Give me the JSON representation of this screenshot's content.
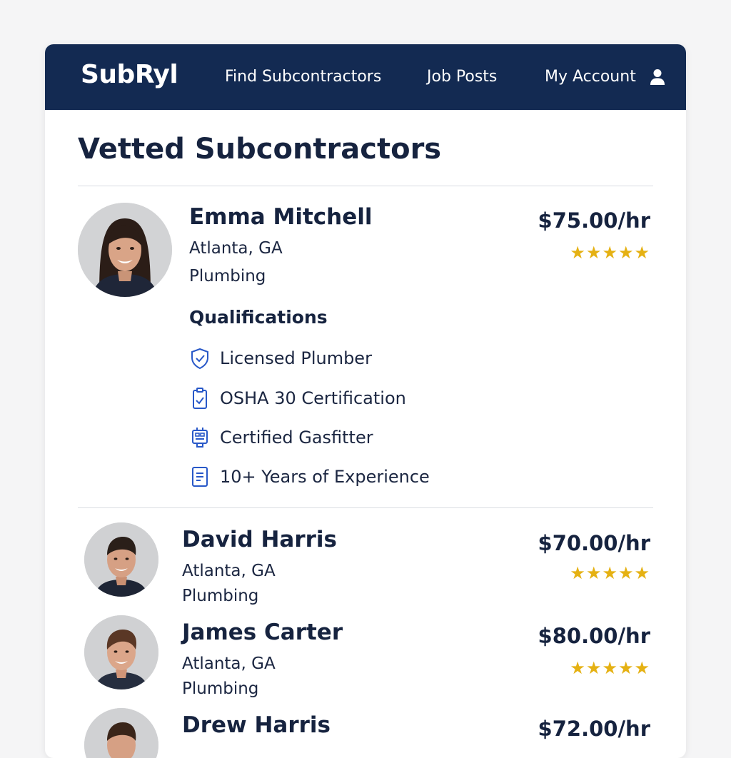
{
  "navbar": {
    "brand": "SubRyl",
    "links": [
      "Find Subcontractors",
      "Job Posts",
      "My Account"
    ],
    "account_icon": "user-icon"
  },
  "page": {
    "title": "Vetted Subcontractors"
  },
  "colors": {
    "navbar_bg": "#132a52",
    "text": "#16233f",
    "star": "#e5b113",
    "icon_blue": "#2858c8"
  },
  "subcontractors": [
    {
      "name": "Emma Mitchell",
      "location": "Atlanta, GA",
      "trade": "Plumbing",
      "rate": "$75.00/hr",
      "rating": 5,
      "stars": "★★★★★",
      "qualifications_heading": "Qualifications",
      "qualifications": [
        {
          "label": "Licensed Plumber",
          "icon": "shield-check-icon"
        },
        {
          "label": "OSHA 30 Certification",
          "icon": "clipboard-check-icon"
        },
        {
          "label": "Certified Gasfitter",
          "icon": "gas-meter-icon"
        },
        {
          "label": "10+ Years of Experience",
          "icon": "document-icon"
        }
      ]
    },
    {
      "name": "David Harris",
      "location": "Atlanta, GA",
      "trade": "Plumbing",
      "rate": "$70.00/hr",
      "rating": 5,
      "stars": "★★★★★"
    },
    {
      "name": "James Carter",
      "location": "Atlanta, GA",
      "trade": "Plumbing",
      "rate": "$80.00/hr",
      "rating": 5,
      "stars": "★★★★★"
    },
    {
      "name": "Drew Harris",
      "rate": "$72.00/hr"
    }
  ]
}
